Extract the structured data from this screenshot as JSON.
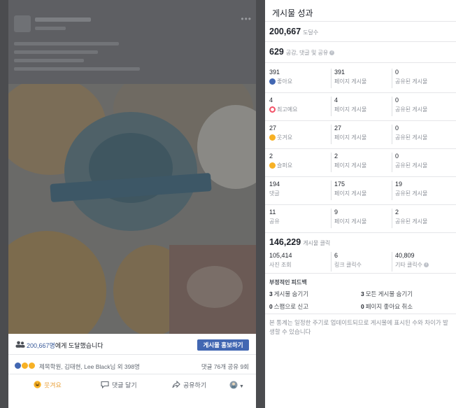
{
  "post": {
    "reach_count": "200,667명",
    "reach_suffix": "에게 도달했습니다",
    "boost_label": "게시물 홍보하기",
    "reaction_names": "제목학원, 김태현, Lee Black님 외 398명",
    "comment_share_counts": "댓글 76개  공유 9회",
    "actions": {
      "haha": "웃겨요",
      "comment": "댓글 달기",
      "share": "공유하기"
    }
  },
  "panel": {
    "title": "게시물 성과",
    "reach": {
      "value": "200,667",
      "label": "도달수"
    },
    "engagement": {
      "value": "629",
      "label": "공감, 댓글 및 공유"
    },
    "rows": [
      {
        "total": "391",
        "label": "좋아요",
        "icon": "like-icon",
        "page": "391",
        "page_label": "페이지 게시물",
        "shared": "0",
        "shared_label": "공유된 게시물"
      },
      {
        "total": "4",
        "label": "최고예요",
        "icon": "love-icon",
        "page": "4",
        "page_label": "페이지 게시물",
        "shared": "0",
        "shared_label": "공유된 게시물"
      },
      {
        "total": "27",
        "label": "웃겨요",
        "icon": "haha-icon",
        "page": "27",
        "page_label": "페이지 게시물",
        "shared": "0",
        "shared_label": "공유된 게시물"
      },
      {
        "total": "2",
        "label": "슬퍼요",
        "icon": "sad-icon",
        "page": "2",
        "page_label": "페이지 게시물",
        "shared": "0",
        "shared_label": "공유된 게시물"
      },
      {
        "total": "194",
        "label": "댓글",
        "icon": "",
        "page": "175",
        "page_label": "페이지 게시물",
        "shared": "19",
        "shared_label": "공유된 게시물"
      },
      {
        "total": "11",
        "label": "공유",
        "icon": "",
        "page": "9",
        "page_label": "페이지 게시물",
        "shared": "2",
        "shared_label": "공유된 게시물"
      }
    ],
    "clicks": {
      "value": "146,229",
      "label": "게시물 클릭",
      "photo": "105,414",
      "photo_label": "사진 조회",
      "link": "6",
      "link_label": "링크 클릭수",
      "other": "40,809",
      "other_label": "기타 클릭수"
    },
    "negative": {
      "title": "부정적인 피드백",
      "hide_post": "3",
      "hide_post_label": "게시물 숨기기",
      "hide_all": "3",
      "hide_all_label": "모든 게시물 숨기기",
      "spam": "0",
      "spam_label": "스팸으로 신고",
      "unlike": "0",
      "unlike_label": "페이지 좋아요 취소"
    },
    "note": "본 통계는 일정한 주기로 업데이트되므로 게시물에 표시된 수와 차이가 발생할 수 있습니다"
  },
  "colors": {
    "like": "#4267b2",
    "love": "#f25268",
    "haha": "#f7b125",
    "sad": "#f7b125",
    "link": "#365899",
    "boost": "#4267b2"
  }
}
